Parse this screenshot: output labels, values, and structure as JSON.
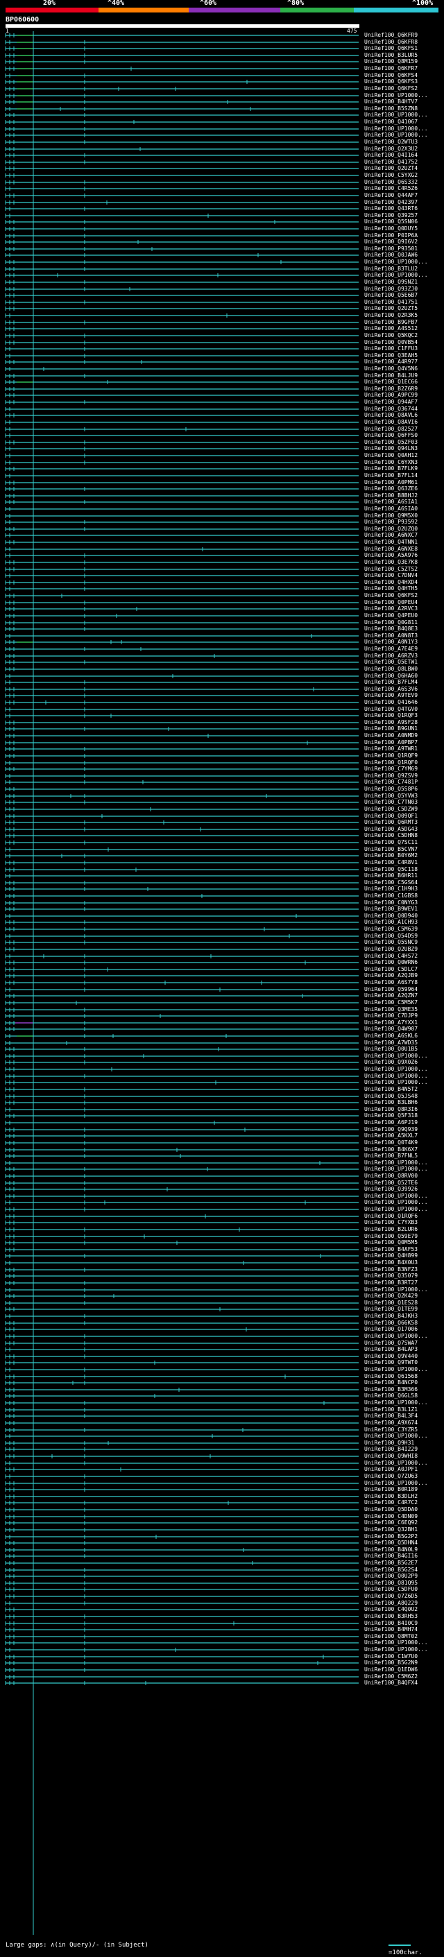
{
  "scale": {
    "ticks": [
      {
        "label": "20%",
        "color": "#e8001b"
      },
      {
        "label": "^40%",
        "color": "#ff7e00"
      },
      {
        "label": "^60%",
        "color": "#8b2fb8"
      },
      {
        "label": "^80%",
        "color": "#2db04a"
      },
      {
        "label": "^100%",
        "color": "#2ec6d3"
      }
    ]
  },
  "query": {
    "title": "BP060600",
    "start": "1",
    "end": "475"
  },
  "colors": {
    "hit_line": "#33cccc",
    "identity_high": "#2db04a",
    "identity_mid": "#8b2fb8",
    "gap_marker": "#33cccc",
    "background": "#000000"
  },
  "hits": [
    "UniRef100_Q6KFR9",
    "UniRef100_Q6KFR8",
    "UniRef100_Q6KFS1",
    "UniRef100_B3LUR5",
    "UniRef100_Q8M159",
    "UniRef100_Q6KFR7",
    "UniRef100_Q6KFS4",
    "UniRef100_Q6KFS3",
    "UniRef100_Q6KFS2",
    "UniRef100_UP1000...",
    "UniRef100_B4HTV7",
    "UniRef100_B5SZN8",
    "UniRef100_UP1000...",
    "UniRef100_Q41067",
    "UniRef100_UP1000...",
    "UniRef100_UP1000...",
    "UniRef100_Q2WTU3",
    "UniRef100_Q2X3U2",
    "UniRef100_Q4I164",
    "UniRef100_Q41752",
    "UniRef100_Q2UZT4",
    "UniRef100_C5YXG2",
    "UniRef100_Q6S332",
    "UniRef100_C4R5Z6",
    "UniRef100_Q44AF7",
    "UniRef100_Q42397",
    "UniRef100_Q43RT6",
    "UniRef100_Q39257",
    "UniRef100_Q5SN06",
    "UniRef100_Q0DUY5",
    "UniRef100_P0IP6A",
    "UniRef100_Q9I6V2",
    "UniRef100_P93501",
    "UniRef100_Q0JAW6",
    "UniRef100_UP1000...",
    "UniRef100_B3TLU2",
    "UniRef100_UP1000...",
    "UniRef100_Q9SNZ1",
    "UniRef100_Q93ZJ0",
    "UniRef100_Q5E6B7",
    "UniRef100_Q41751",
    "UniRef100_Q2UZT5",
    "UniRef100_Q2R3K5",
    "UniRef100_B9GFB7",
    "UniRef100_A4S512",
    "UniRef100_Q5KQC2",
    "UniRef100_Q0VB54",
    "UniRef100_C1FFU3",
    "UniRef100_Q3EAH5",
    "UniRef100_A4R977",
    "UniRef100_Q4V5N6",
    "UniRef100_B4LJU9",
    "UniRef100_Q1EC66",
    "UniRef100_B2Z6R9",
    "UniRef100_A9PC99",
    "UniRef100_Q94AF7",
    "UniRef100_Q36744",
    "UniRef100_Q8AVL6",
    "UniRef100_Q8AVI6",
    "UniRef100_Q82527",
    "UniRef100_Q6FFS0",
    "UniRef100_Q5ZF03",
    "UniRef100_Q94LN3",
    "UniRef100_Q0AH12",
    "UniRef100_C6YXN3",
    "UniRef100_B7FLK9",
    "UniRef100_B7FL14",
    "UniRef100_A0PM61",
    "UniRef100_Q63ZE6",
    "UniRef100_B8BHJ2",
    "UniRef100_A6SIA1",
    "UniRef100_A6SIA0",
    "UniRef100_Q9M5X0",
    "UniRef100_P93592",
    "UniRef100_Q2UZQ0",
    "UniRef100_A6NXC7",
    "UniRef100_Q4TNN1",
    "UniRef100_A6NXE8",
    "UniRef100_A5A976",
    "UniRef100_Q3E7K8",
    "UniRef100_C5ZTS2",
    "UniRef100_C7DNV4",
    "UniRef100_Q4HXD4",
    "UniRef100_Q4HTH5",
    "UniRef100_Q6KFS2",
    "UniRef100_Q0PEU4",
    "UniRef100_A2RVC3",
    "UniRef100_Q4PEU0",
    "UniRef100_Q0G811",
    "UniRef100_B4Q8E3",
    "UniRef100_A0N8T3",
    "UniRef100_A0N1Y3",
    "UniRef100_A7E4E9",
    "UniRef100_A6RZV3",
    "UniRef100_Q5ETW1",
    "UniRef100_Q8LBW0",
    "UniRef100_Q6HA60",
    "UniRef100_B7FLM4",
    "UniRef100_A6S3V6",
    "UniRef100_A9TEV9",
    "UniRef100_Q41646",
    "UniRef100_Q4TGV0",
    "UniRef100_Q1RQF3",
    "UniRef100_A9SF28",
    "UniRef100_B9GUN1",
    "UniRef100_A0NMD9",
    "UniRef100_A0PBP7",
    "UniRef100_A9TWR1",
    "UniRef100_Q1RQF9",
    "UniRef100_Q1RQF0",
    "UniRef100_C7YM69",
    "UniRef100_Q9ZSV9",
    "UniRef100_C7481P",
    "UniRef100_Q5S8P6",
    "UniRef100_Q5YVW3",
    "UniRef100_C7TN03",
    "UniRef100_C5DZW9",
    "UniRef100_Q09QF1",
    "UniRef100_Q6RMT3",
    "UniRef100_A5DG43",
    "UniRef100_C5DHN8",
    "UniRef100_Q7SC11",
    "UniRef100_B5CVN7",
    "UniRef100_B0Y6M2",
    "UniRef100_C4R8V1",
    "UniRef100_Q5C118",
    "UniRef100_B6HR11",
    "UniRef100_C5GS64",
    "UniRef100_C1H9H3",
    "UniRef100_C1GBS8",
    "UniRef100_C0NYG3",
    "UniRef100_B9WEV1",
    "UniRef100_Q0D940",
    "UniRef100_A1CH93",
    "UniRef100_C5M639",
    "UniRef100_Q54DS9",
    "UniRef100_Q5SNC9",
    "UniRef100_Q2UBZ9",
    "UniRef100_C4HS72",
    "UniRef100_Q0WRN6",
    "UniRef100_C5DLC7",
    "UniRef100_A2QJB9",
    "UniRef100_A6S7Y8",
    "UniRef100_Q59964",
    "UniRef100_A2QZN7",
    "UniRef100_C5M5K7",
    "UniRef100_Q3ME35",
    "UniRef100_C7DJP9",
    "UniRef100_A7YXX1",
    "UniRef100_Q4W907",
    "UniRef100_A6SKL6",
    "UniRef100_A7WD35",
    "UniRef100_Q0U1B5",
    "UniRef100_UP1000...",
    "UniRef100_Q9X0Z6",
    "UniRef100_UP1000...",
    "UniRef100_UP1000...",
    "UniRef100_UP1000...",
    "UniRef100_B4N5T2",
    "UniRef100_Q5JS48",
    "UniRef100_B3LBH6",
    "UniRef100_Q8R3I6",
    "UniRef100_Q5F318",
    "UniRef100_A6PJ19",
    "UniRef100_Q9Q939",
    "UniRef100_A5KXL7",
    "UniRef100_Q0T4K9",
    "UniRef100_B4K6X7",
    "UniRef100_B7FNL5",
    "UniRef100_UP1000...",
    "UniRef100_UP1000...",
    "UniRef100_Q8RV00",
    "UniRef100_Q52TE6",
    "UniRef100_Q39926",
    "UniRef100_UP1000...",
    "UniRef100_UP1000...",
    "UniRef100_UP1000...",
    "UniRef100_Q1RQF6",
    "UniRef100_C7YXB3",
    "UniRef100_B2LUR6",
    "UniRef100_Q59E79",
    "UniRef100_Q0M5M5",
    "UniRef100_B4AF53",
    "UniRef100_Q4H899",
    "UniRef100_B4X0U3",
    "UniRef100_B3NFZ3",
    "UniRef100_Q35079",
    "UniRef100_B3RT27",
    "UniRef100_UP1000...",
    "UniRef100_Q2K429",
    "UniRef100_Q1ES28",
    "UniRef100_Q1TE99",
    "UniRef100_B4JKH3",
    "UniRef100_Q66K58",
    "UniRef100_Q17006",
    "UniRef100_UP1000...",
    "UniRef100_Q7SWA7",
    "UniRef100_B4LAP3",
    "UniRef100_Q9V440",
    "UniRef100_Q9TWT0",
    "UniRef100_UP1000...",
    "UniRef100_Q61568",
    "UniRef100_B4NCP0",
    "UniRef100_B3M366",
    "UniRef100_Q6GL58",
    "UniRef100_UP1000...",
    "UniRef100_B3L1Z1",
    "UniRef100_B4L3F4",
    "UniRef100_A9X674",
    "UniRef100_C3YZR5",
    "UniRef100_UP1000...",
    "UniRef100_Q9H31",
    "UniRef100_B4I229",
    "UniRef100_Q9WHI8",
    "UniRef100_UP1000...",
    "UniRef100_A0JPF1",
    "UniRef100_Q7ZU63",
    "UniRef100_UP1000...",
    "UniRef100_B0R189",
    "UniRef100_B3DLH2",
    "UniRef100_C4R7C2",
    "UniRef100_Q5DDA0",
    "UniRef100_C4DN09",
    "UniRef100_C6EQ92",
    "UniRef100_Q32BH1",
    "UniRef100_B5G2P2",
    "UniRef100_Q5DHN4",
    "UniRef100_B4N0L9",
    "UniRef100_B4GI16",
    "UniRef100_B5G2E7",
    "UniRef100_B5G2S4",
    "UniRef100_Q0U2P9",
    "UniRef100_Q81Q95",
    "UniRef100_C5DFU0",
    "UniRef100_Q7Z6D5",
    "UniRef100_A8Q229",
    "UniRef100_C4Q0U2",
    "UniRef100_B3RH53",
    "UniRef100_B4I0C9",
    "UniRef100_B4MH74",
    "UniRef100_Q8MT02",
    "UniRef100_UP1000...",
    "UniRef100_UP1000...",
    "UniRef100_C1W7U0",
    "UniRef100_B5G2N9",
    "UniRef100_Q1EDW6",
    "UniRef100_C5M6Z2",
    "UniRef100_B4QFX4"
  ],
  "legend": {
    "text": "Large gaps: ∧(in Query)/- (in Subject)",
    "scale": "=100char."
  }
}
